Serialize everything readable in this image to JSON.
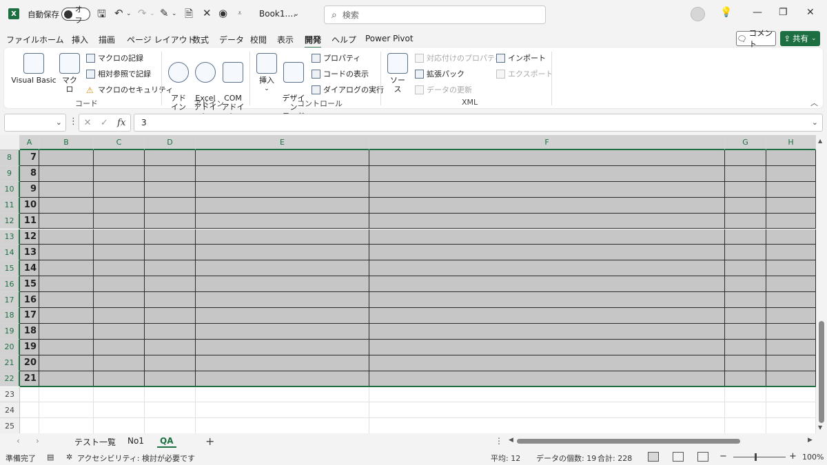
{
  "titlebar": {
    "autosave_label": "自動保存",
    "autosave_state": "オフ",
    "doc_title": "Book1.…",
    "search_placeholder": "検索"
  },
  "menu": {
    "tabs": [
      "ファイル",
      "ホーム",
      "挿入",
      "描画",
      "ページ レイアウト",
      "数式",
      "データ",
      "校閲",
      "表示",
      "開発",
      "ヘルプ",
      "Power Pivot"
    ],
    "active_index": 9,
    "comment_label": "コメント",
    "share_label": "共有"
  },
  "ribbon": {
    "code": {
      "label": "コード",
      "visual_basic": "Visual Basic",
      "macro": "マクロ",
      "record_macro": "マクロの記録",
      "relative_ref": "相対参照で記録",
      "macro_security": "マクロのセキュリティ"
    },
    "addins": {
      "label": "アドイン",
      "addin": "アド\nイン",
      "excel_addin": "Excel\nアドイン",
      "com_addin": "COM\nアドイン"
    },
    "controls": {
      "label": "コントロール",
      "insert": "挿入",
      "design_mode": "デザイン\nモード",
      "properties": "プロパティ",
      "view_code": "コードの表示",
      "run_dialog": "ダイアログの実行"
    },
    "xml": {
      "label": "XML",
      "source": "ソース",
      "map_properties": "対応付けのプロパティ",
      "expansion_packs": "拡張パック",
      "refresh_data": "データの更新",
      "import": "インポート",
      "export": "エクスポート"
    }
  },
  "formula_bar": {
    "name_box": "",
    "fx": "fx",
    "value": "3"
  },
  "grid": {
    "columns": [
      "A",
      "B",
      "C",
      "D",
      "E",
      "F",
      "G",
      "H"
    ],
    "selected_columns": [
      "A",
      "B",
      "C",
      "D",
      "E",
      "F",
      "G",
      "H"
    ],
    "rows": [
      {
        "row": "8",
        "a": "7",
        "selected": true
      },
      {
        "row": "9",
        "a": "8",
        "selected": true
      },
      {
        "row": "10",
        "a": "9",
        "selected": true
      },
      {
        "row": "11",
        "a": "10",
        "selected": true
      },
      {
        "row": "12",
        "a": "11",
        "selected": true
      },
      {
        "row": "13",
        "a": "12",
        "selected": true
      },
      {
        "row": "14",
        "a": "13",
        "selected": true
      },
      {
        "row": "15",
        "a": "14",
        "selected": true
      },
      {
        "row": "16",
        "a": "15",
        "selected": true
      },
      {
        "row": "17",
        "a": "16",
        "selected": true
      },
      {
        "row": "18",
        "a": "17",
        "selected": true
      },
      {
        "row": "19",
        "a": "18",
        "selected": true
      },
      {
        "row": "20",
        "a": "19",
        "selected": true
      },
      {
        "row": "21",
        "a": "20",
        "selected": true
      },
      {
        "row": "22",
        "a": "21",
        "selected": true
      },
      {
        "row": "23",
        "a": "",
        "selected": false
      },
      {
        "row": "24",
        "a": "",
        "selected": false
      },
      {
        "row": "25",
        "a": "",
        "selected": false
      }
    ]
  },
  "sheets": {
    "tabs": [
      "テスト一覧",
      "No1",
      "QA"
    ],
    "active_index": 2
  },
  "status": {
    "ready": "準備完了",
    "accessibility": "アクセシビリティ: 検討が必要です",
    "average": "平均: 12",
    "count": "データの個数: 19",
    "sum": "合計: 228",
    "zoom": "100%"
  },
  "colors": {
    "accent": "#1d6f42",
    "selection_fill": "#c6c6c6"
  }
}
